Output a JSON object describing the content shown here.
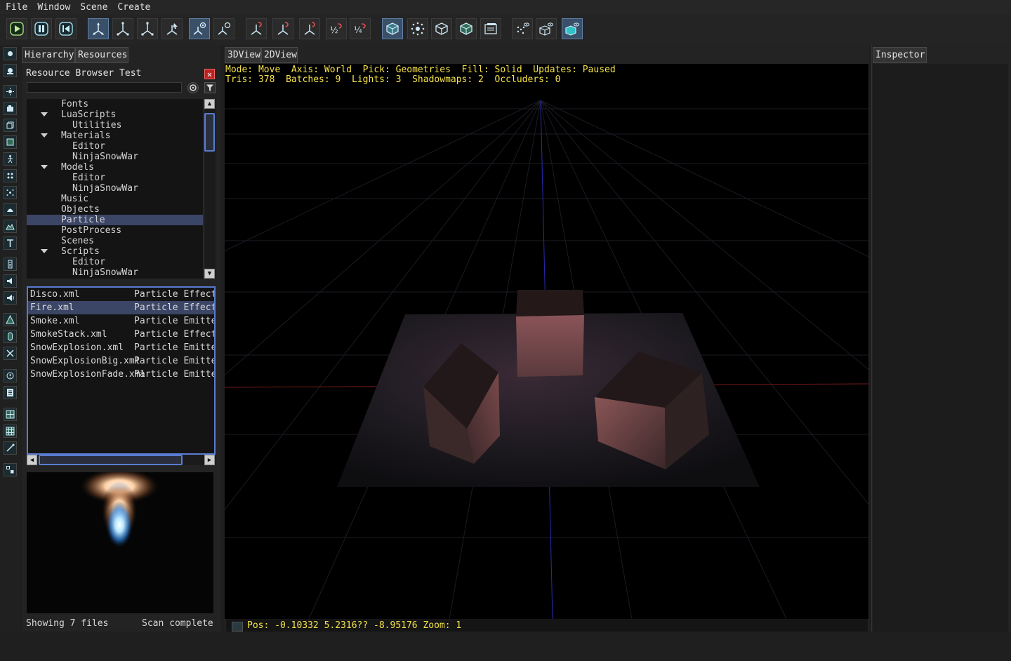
{
  "menu": [
    "File",
    "Window",
    "Scene",
    "Create"
  ],
  "toolbar": {
    "buttons": [
      "play",
      "pause",
      "rewind",
      "move-tool",
      "rotate-tool",
      "scale-tool",
      "select-tool",
      "pick-tool",
      "camera-tool",
      "snap-move",
      "snap-rotate",
      "snap-scale",
      "snap-half",
      "snap-quarter",
      "fill-solid",
      "fill-points",
      "fill-wireframe",
      "pick-geometries",
      "pick-components",
      "view-points",
      "view-box",
      "view-solid"
    ]
  },
  "left_panel": {
    "tabs": [
      "Hierarchy",
      "Resources"
    ],
    "active_tab": "Resources",
    "title": "Resource Browser Test",
    "search_placeholder": "",
    "tree": [
      {
        "label": "Fonts",
        "depth": 1,
        "expanded": null
      },
      {
        "label": "LuaScripts",
        "depth": 1,
        "expanded": true
      },
      {
        "label": "Utilities",
        "depth": 2,
        "expanded": null
      },
      {
        "label": "Materials",
        "depth": 1,
        "expanded": true
      },
      {
        "label": "Editor",
        "depth": 2,
        "expanded": null
      },
      {
        "label": "NinjaSnowWar",
        "depth": 2,
        "expanded": null
      },
      {
        "label": "Models",
        "depth": 1,
        "expanded": true
      },
      {
        "label": "Editor",
        "depth": 2,
        "expanded": null
      },
      {
        "label": "NinjaSnowWar",
        "depth": 2,
        "expanded": null
      },
      {
        "label": "Music",
        "depth": 1,
        "expanded": null
      },
      {
        "label": "Objects",
        "depth": 1,
        "expanded": null
      },
      {
        "label": "Particle",
        "depth": 1,
        "expanded": null,
        "selected": true
      },
      {
        "label": "PostProcess",
        "depth": 1,
        "expanded": null
      },
      {
        "label": "Scenes",
        "depth": 1,
        "expanded": null
      },
      {
        "label": "Scripts",
        "depth": 1,
        "expanded": true
      },
      {
        "label": "Editor",
        "depth": 2,
        "expanded": null
      },
      {
        "label": "NinjaSnowWar",
        "depth": 2,
        "expanded": null
      }
    ],
    "files": [
      {
        "name": "Disco.xml",
        "type": "Particle Effect"
      },
      {
        "name": "Fire.xml",
        "type": "Particle Effect",
        "selected": true
      },
      {
        "name": "Smoke.xml",
        "type": "Particle Emitter"
      },
      {
        "name": "SmokeStack.xml",
        "type": "Particle Effect"
      },
      {
        "name": "SnowExplosion.xml",
        "type": "Particle Emitter"
      },
      {
        "name": "SnowExplosionBig.xml",
        "type": "Particle Emitter"
      },
      {
        "name": "SnowExplosionFade.xml",
        "type": "Particle Emitter"
      }
    ],
    "status_left": "Showing 7 files",
    "status_right": "Scan complete"
  },
  "viewport": {
    "tabs": [
      "3DView",
      "2DView"
    ],
    "active_tab": "3DView",
    "stats_line1": "Mode: Move  Axis: World  Pick: Geometries  Fill: Solid  Updates: Paused",
    "stats_line2": "Tris: 378  Batches: 9  Lights: 3  Shadowmaps: 2  Occluders: 0",
    "status": "Pos: -0.10332 5.2316?? -8.95176 Zoom: 1"
  },
  "inspector": {
    "tab": "Inspector"
  },
  "colors": {
    "stats_text": "#f5e24a",
    "selection": "#3b4566",
    "focus_border": "#5a7cd0",
    "close_button": "#b22222"
  }
}
